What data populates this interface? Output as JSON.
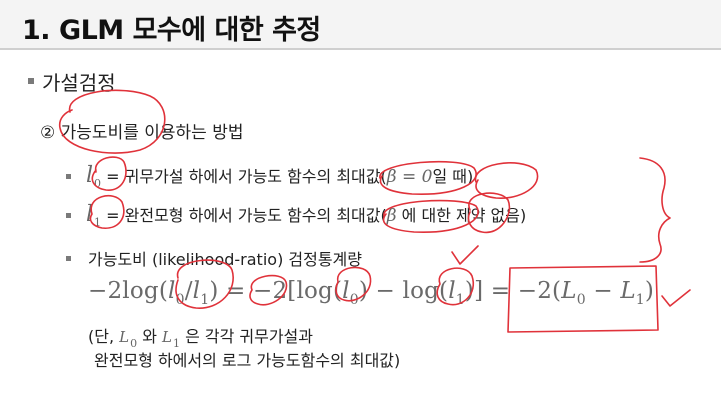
{
  "title": "1. GLM 모수에 대한 추정",
  "section": "가설검정",
  "subsection": "② 가능도비를 이용하는 방법",
  "items": [
    {
      "symbol": "l",
      "subscript": "0",
      "text_pre": "= 귀무가설 하에서 가능도 함수의 최대값(",
      "beta_expr": "β = 0",
      "text_post": "일 때)"
    },
    {
      "symbol": "l",
      "subscript": "1",
      "text_pre": "= 완전모형 하에서 가능도 함수의 최대값(",
      "beta_expr": "β",
      "text_post": " 에 대한 제약 없음)"
    }
  ],
  "lr_heading": "가능도비 (likelihood-ratio) 검정통계량",
  "formula": {
    "part1": "−2log(",
    "l0": "l",
    "l0_sub": "0",
    "slash": "/",
    "l1": "l",
    "l1_sub": "1",
    "part2": ") = −2[log(",
    "part3": ") − log(",
    "part4": ")] = −2(",
    "L0": "L",
    "L0_sub": "0",
    "minus": " − ",
    "L1": "L",
    "L1_sub": "1",
    "close": ")"
  },
  "note": {
    "line1_a": "(단, ",
    "L0": "L",
    "L0_sub": "0",
    "line1_b": " 와 ",
    "L1": "L",
    "L1_sub": "1",
    "line1_c": " 은 각각 귀무가설과",
    "line2": "완전모형 하에서의 로그 가능도함수의 최대값)"
  },
  "colors": {
    "annotation": "#e0323a",
    "bullet": "#7a7a7a",
    "header_bg": "#f4f4f4"
  }
}
